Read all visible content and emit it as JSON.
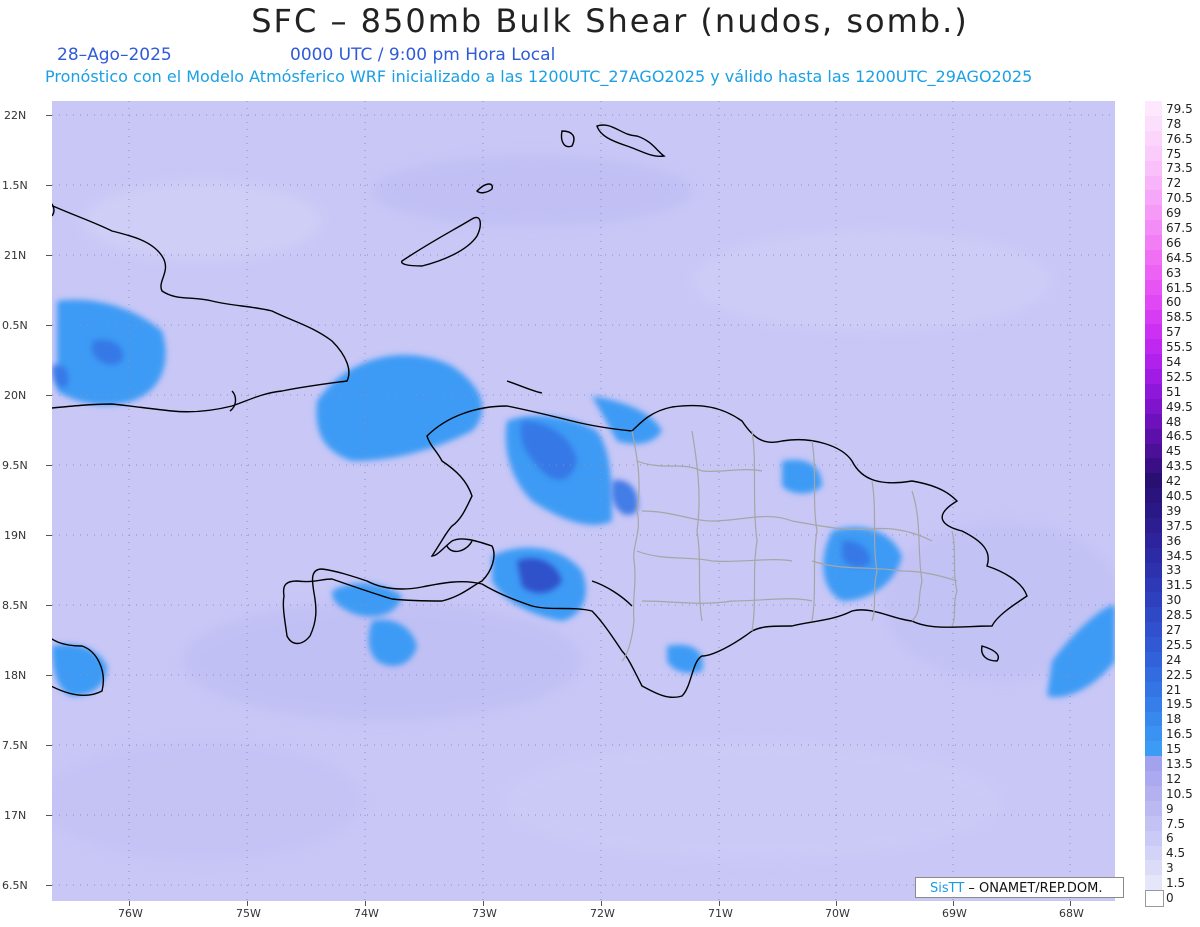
{
  "title": "SFC – 850mb Bulk Shear (nudos, somb.)",
  "date": "28–Ago–2025",
  "valid_time": "0000 UTC / 9:00 pm Hora Local",
  "forecast_line": "Pronóstico con el Modelo Atmósferico WRF inicializado a las 1200UTC_27AGO2025 y válido hasta las  1200UTC_29AGO2025",
  "credit": {
    "brand": "SisTT",
    "text": " – ONAMET/REP.DOM."
  },
  "lat_labels": [
    "22N",
    "1.5N",
    "21N",
    "0.5N",
    "20N",
    "9.5N",
    "19N",
    "8.5N",
    "18N",
    "7.5N",
    "17N",
    "6.5N"
  ],
  "lon_labels": [
    "76W",
    "75W",
    "74W",
    "73W",
    "72W",
    "71W",
    "70W",
    "69W",
    "68W"
  ],
  "colorbar": {
    "labels": [
      "0",
      "1.5",
      "3",
      "4.5",
      "6",
      "7.5",
      "9",
      "10.5",
      "12",
      "13.5",
      "15",
      "16.5",
      "18",
      "19.5",
      "21",
      "22.5",
      "24",
      "25.5",
      "27",
      "28.5",
      "30",
      "31.5",
      "33",
      "34.5",
      "36",
      "37.5",
      "39",
      "40.5",
      "42",
      "43.5",
      "45",
      "46.5",
      "48",
      "49.5",
      "51",
      "52.5",
      "54",
      "55.5",
      "57",
      "58.5",
      "60",
      "61.5",
      "63",
      "64.5",
      "66",
      "67.5",
      "69",
      "70.5",
      "72",
      "73.5",
      "75",
      "76.5",
      "78",
      "79.5"
    ],
    "colors": [
      "#ffffff",
      "#e6e6fb",
      "#dcdcf9",
      "#d3d2f7",
      "#cbcaf6",
      "#c3c2f4",
      "#bbb9f2",
      "#b3b1f0",
      "#aba9ef",
      "#a3a2ee",
      "#3c9bf5",
      "#3a93f2",
      "#3889ee",
      "#367fea",
      "#3475e5",
      "#336ce0",
      "#3262da",
      "#3159d3",
      "#3050cd",
      "#2f48c6",
      "#2f40bf",
      "#2e39b7",
      "#2e31ae",
      "#2d2aa5",
      "#2d239b",
      "#2c1d91",
      "#2b1887",
      "#2a137d",
      "#2a0f73",
      "#3a0f86",
      "#4b0f98",
      "#5c10aa",
      "#6d12bb",
      "#7e14cb",
      "#8f17d9",
      "#a01ce4",
      "#b021ec",
      "#bf28f1",
      "#cc31f3",
      "#d73cf4",
      "#df48f4",
      "#e655f4",
      "#eb62f4",
      "#ef70f5",
      "#f27ef6",
      "#f48cf7",
      "#f69af8",
      "#f7a7f9",
      "#f8b4fa",
      "#f9c0fb",
      "#facbfb",
      "#fbd5fc",
      "#fcdffd",
      "#fde8fd"
    ]
  }
}
